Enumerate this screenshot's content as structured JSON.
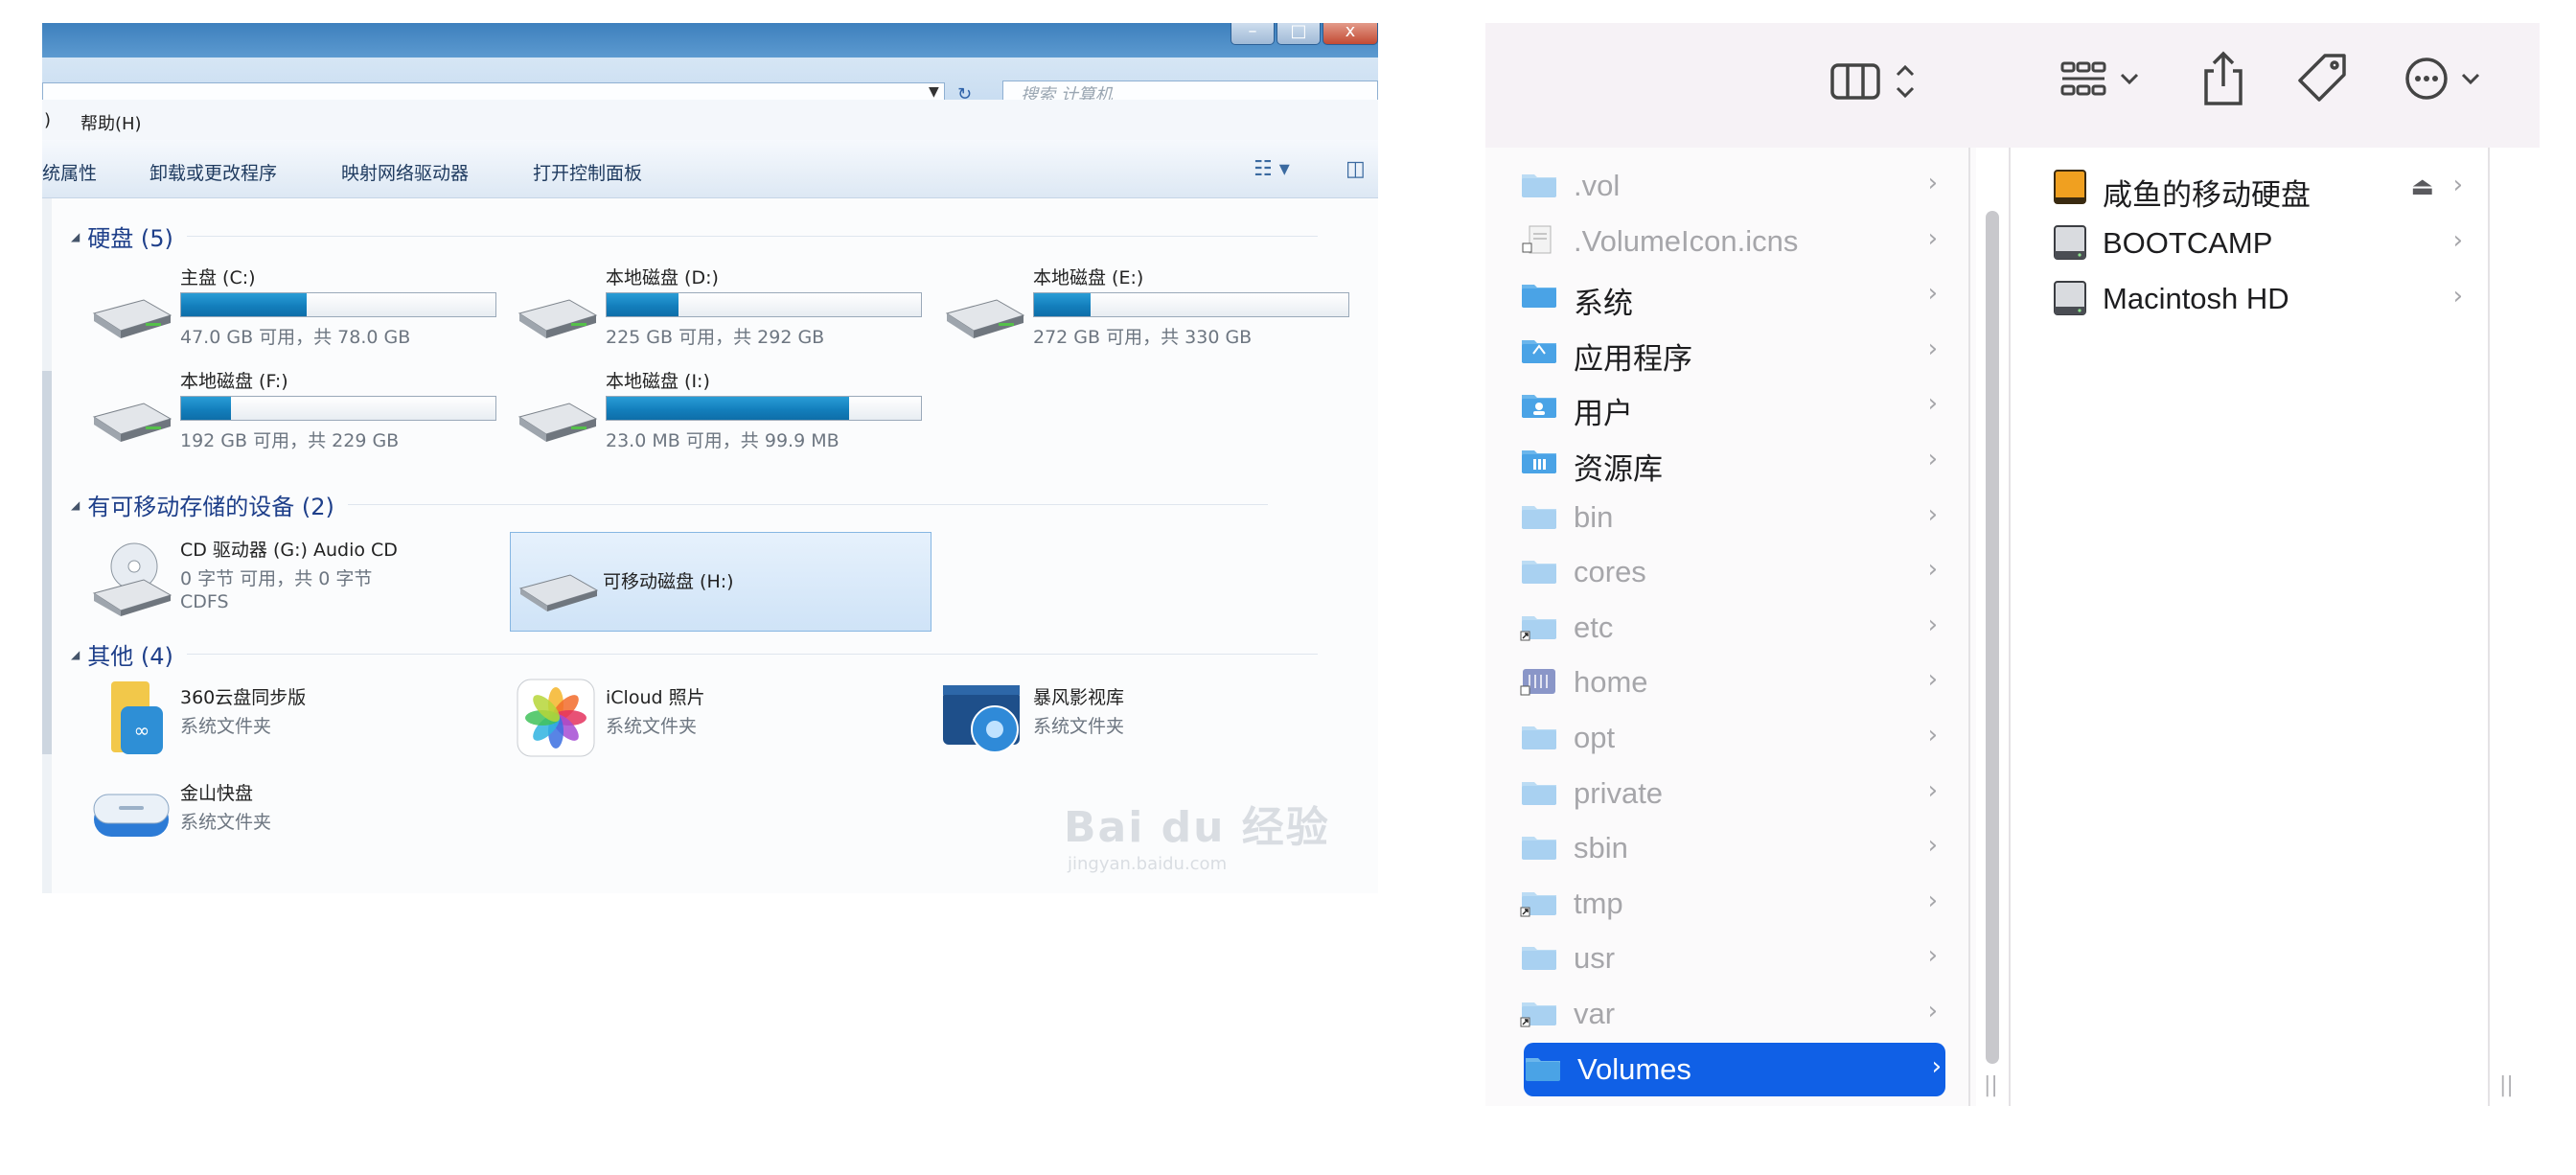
{
  "windows_explorer": {
    "search_placeholder": "搜索 计算机",
    "menu": {
      "partial_paren": ")",
      "help": "帮助(H)"
    },
    "toolbar": {
      "properties": "统属性",
      "uninstall": "卸载或更改程序",
      "map_drive": "映射网络驱动器",
      "control_panel": "打开控制面板"
    },
    "groups": {
      "hard_disks": "硬盘 (5)",
      "removable": "有可移动存储的设备 (2)",
      "other": "其他 (4)"
    },
    "drives": [
      {
        "name": "主盘 (C:)",
        "free_text": "47.0 GB 可用，共 78.0 GB",
        "used_fraction": 0.4
      },
      {
        "name": "本地磁盘 (D:)",
        "free_text": "225 GB 可用，共 292 GB",
        "used_fraction": 0.23
      },
      {
        "name": "本地磁盘 (E:)",
        "free_text": "272 GB 可用，共 330 GB",
        "used_fraction": 0.18
      },
      {
        "name": "本地磁盘 (F:)",
        "free_text": "192 GB 可用，共 229 GB",
        "used_fraction": 0.16
      },
      {
        "name": "本地磁盘 (I:)",
        "free_text": "23.0 MB 可用，共 99.9 MB",
        "used_fraction": 0.77
      }
    ],
    "removable_items": [
      {
        "name": "CD 驱动器 (G:) Audio CD",
        "sub": "0 字节 可用，共 0 字节",
        "fs": "CDFS"
      },
      {
        "name": "可移动磁盘 (H:)"
      }
    ],
    "other_items": [
      {
        "name": "360云盘同步版",
        "sub": "系统文件夹"
      },
      {
        "name": "iCloud 照片",
        "sub": "系统文件夹"
      },
      {
        "name": "暴风影视库",
        "sub": "系统文件夹"
      },
      {
        "name": "金山快盘",
        "sub": "系统文件夹"
      }
    ],
    "watermark": {
      "logo": "Bai du 经验",
      "url": "jingyan.baidu.com"
    }
  },
  "mac_finder": {
    "column1": [
      {
        "name": ".vol",
        "icon": "folder-icon",
        "hidden": true
      },
      {
        "name": ".VolumeIcon.icns",
        "icon": "file-alias-icon",
        "hidden": true
      },
      {
        "name": "系统",
        "icon": "folder-icon",
        "hidden": false
      },
      {
        "name": "应用程序",
        "icon": "applications-folder-icon",
        "hidden": false
      },
      {
        "name": "用户",
        "icon": "users-folder-icon",
        "hidden": false
      },
      {
        "name": "资源库",
        "icon": "library-folder-icon",
        "hidden": false
      },
      {
        "name": "bin",
        "icon": "folder-icon",
        "hidden": true
      },
      {
        "name": "cores",
        "icon": "folder-icon",
        "hidden": true
      },
      {
        "name": "etc",
        "icon": "folder-alias-icon",
        "hidden": true
      },
      {
        "name": "home",
        "icon": "network-folder-icon",
        "hidden": true
      },
      {
        "name": "opt",
        "icon": "folder-icon",
        "hidden": true
      },
      {
        "name": "private",
        "icon": "folder-icon",
        "hidden": true
      },
      {
        "name": "sbin",
        "icon": "folder-icon",
        "hidden": true
      },
      {
        "name": "tmp",
        "icon": "folder-alias-icon",
        "hidden": true
      },
      {
        "name": "usr",
        "icon": "folder-icon",
        "hidden": true
      },
      {
        "name": "var",
        "icon": "folder-alias-icon",
        "hidden": true
      },
      {
        "name": "Volumes",
        "icon": "folder-icon",
        "hidden": true,
        "selected": true
      }
    ],
    "column2": [
      {
        "name": "咸鱼的移动硬盘",
        "icon": "external-drive-icon",
        "ejectable": true
      },
      {
        "name": "BOOTCAMP",
        "icon": "internal-drive-icon",
        "ejectable": false
      },
      {
        "name": "Macintosh HD",
        "icon": "internal-drive-icon",
        "ejectable": false
      }
    ],
    "colors": {
      "selection": "#1060e6",
      "folder_blue": "#5ab0e8",
      "external_drive": "#f0a020"
    }
  }
}
